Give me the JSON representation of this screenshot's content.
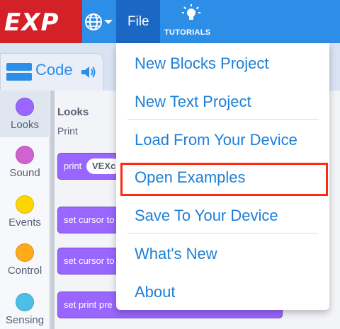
{
  "topbar": {
    "logo_text": "EXP",
    "file_label": "File",
    "tutorials_label": "TUTORIALS",
    "colors": {
      "bar": "#2d8ee8",
      "logo_bg": "#d42027",
      "file_active": "#1b67c4"
    },
    "icons": [
      "globe-icon",
      "chevron-down-icon",
      "lightbulb-icon"
    ]
  },
  "workspace": {
    "code_tab_label": "Code",
    "categories": [
      {
        "label": "Looks",
        "color": "#9966ff"
      },
      {
        "label": "Sound",
        "color": "#cf63cf"
      },
      {
        "label": "Events",
        "color": "#ffd500"
      },
      {
        "label": "Control",
        "color": "#ffab19"
      },
      {
        "label": "Sensing",
        "color": "#4cbfe6"
      }
    ],
    "palette": {
      "heading": "Looks",
      "subheading": "Print",
      "blocks": [
        {
          "text": "print",
          "pill": "VEXc"
        },
        {
          "text": "set cursor to"
        },
        {
          "text": "set cursor to"
        },
        {
          "text": "set print pre"
        }
      ]
    }
  },
  "dropdown": {
    "items": [
      "New Blocks Project",
      "New Text Project",
      "Load From Your Device",
      "Open Examples",
      "Save To Your Device",
      "What's New",
      "About"
    ],
    "highlighted": "Open Examples",
    "colors": {
      "text": "#1d7fd6",
      "highlight_border": "#ff2a12"
    }
  }
}
